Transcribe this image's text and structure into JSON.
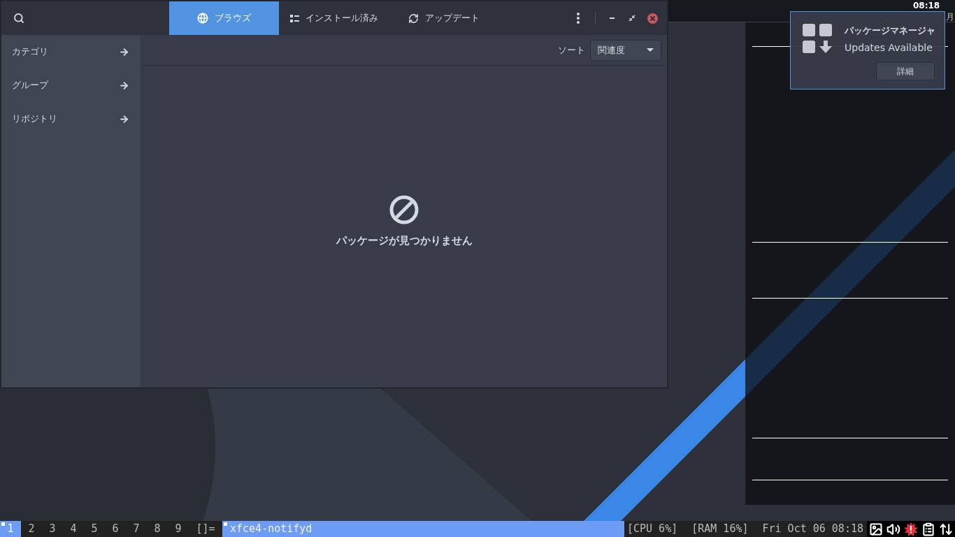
{
  "window": {
    "tabs": [
      {
        "label": "ブラウズ",
        "selected": true
      },
      {
        "label": "インストール済み",
        "selected": false
      },
      {
        "label": "アップデート",
        "selected": false
      }
    ]
  },
  "sidebar": {
    "items": [
      {
        "label": "カテゴリ"
      },
      {
        "label": "グループ"
      },
      {
        "label": "リポジトリ"
      }
    ]
  },
  "toolbar": {
    "sort_label": "ソート",
    "sort_value": "関連度"
  },
  "empty_state": {
    "message": "パッケージが見つかりません"
  },
  "desktop": {
    "clock": "08:18",
    "date": "月"
  },
  "notification": {
    "title": "パッケージマネージャ",
    "body": "Updates Available",
    "button": "詳細"
  },
  "panel": {
    "workspaces": [
      {
        "label": "1",
        "selected": true,
        "occupied": true
      },
      {
        "label": "2",
        "selected": false,
        "occupied": false
      },
      {
        "label": "3",
        "selected": false,
        "occupied": false
      },
      {
        "label": "4",
        "selected": false,
        "occupied": false
      },
      {
        "label": "5",
        "selected": false,
        "occupied": false
      },
      {
        "label": "6",
        "selected": false,
        "occupied": false
      },
      {
        "label": "7",
        "selected": false,
        "occupied": false
      },
      {
        "label": "8",
        "selected": false,
        "occupied": false
      },
      {
        "label": "9",
        "selected": false,
        "occupied": false
      }
    ],
    "layout": "[]=",
    "window_title": "xfce4-notifyd",
    "floating": true,
    "status": [
      "[CPU 6%]",
      "[RAM 16%]",
      "Fri Oct 06 08:18"
    ]
  }
}
